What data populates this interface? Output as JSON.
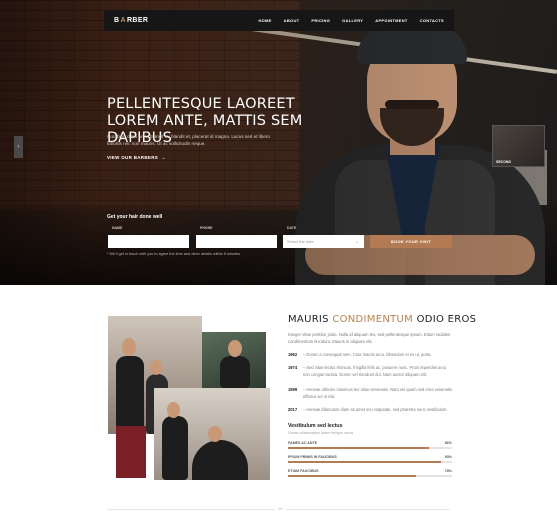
{
  "nav": {
    "logo_prefix": "B",
    "logo_accent": "A",
    "logo_suffix": "RBER",
    "items": [
      "HOME",
      "ABOUT",
      "PRICING",
      "GALLERY",
      "APPOINTMENT",
      "CONTACTS"
    ]
  },
  "hero": {
    "title_line1": "PELLENTESQUE LAOREET",
    "title_line2": "LOREM ANTE, MATTIS SEM DAPIBUS",
    "desc_line1": "Curabitur diam arcu, blandit eu blandit et, placerat id magna. Lacus sed et libero",
    "desc_line2": "lobortis nec non mauris. Ut ac sollicitudin neque.",
    "link": "VIEW OUR BARBERS",
    "slider_thumb_label": "SECOND"
  },
  "booking": {
    "heading": "Get your hair done well",
    "name_label": "NAME",
    "phone_label": "PHONE",
    "date_label": "DATE",
    "date_placeholder": "Select the date",
    "button": "BOOK YOUR VISIT",
    "note": "* We'll get in touch with you to agree the time and other details within 5 minutes."
  },
  "about": {
    "title_a": "MAURIS ",
    "title_accent": "CONDIMENTUM",
    "title_b": " ODIO EROS",
    "text": "Integer vitae porttitor justo. Nulla id aliquam leo, sed pellentesque ipsum. Etiam sodales condimentum tincidunt. Mauris in aliquam elit.",
    "timeline": [
      {
        "year": "1962",
        "text": "– Donec a consequat sem. Cras mauris arcu, bibendum et ex ut, porta."
      },
      {
        "year": "1974",
        "text": "– Sed vitae lectus rhoncus, fringilla felis ac, posuere nunc. Proin imperdiet arcu non congue lacinia. Donec vel tincidunt dui. Nam auctor aliquam elit."
      },
      {
        "year": "1999",
        "text": "– Aenean ultricies maximus leo vitae venenatis. Nam vel quam sed eros venenatis efficitur vel ut nisi."
      },
      {
        "year": "2017",
        "text": "– Aenean bibendum diam sit amet orci vulputate, sed pharetra nunc vestibulum."
      }
    ],
    "skills_title": "Vestibulum sed lectus",
    "skills_sub": "Donec ullamcorper lorem tempor lacus",
    "skills": [
      {
        "label": "FAMES AC ANTE",
        "value": "86%",
        "fraction": 0.86
      },
      {
        "label": "IPSUM PRIMIS IN FAUCIBUS",
        "value": "93%",
        "fraction": 0.93
      },
      {
        "label": "ETIAM FAUCIBUS",
        "value": "78%",
        "fraction": 0.78
      }
    ]
  },
  "colors": {
    "accent": "#b27b53",
    "nav_bg": "#161616"
  }
}
